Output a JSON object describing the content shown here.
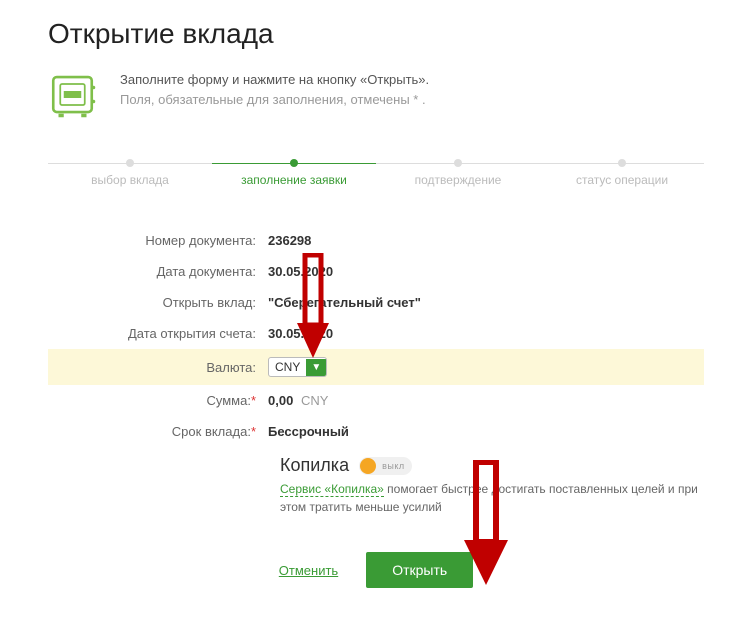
{
  "title": "Открытие вклада",
  "intro": {
    "line1": "Заполните форму и нажмите на кнопку «Открыть».",
    "line2": "Поля, обязательные для заполнения, отмечены * ."
  },
  "steps": {
    "s1": "выбор вклада",
    "s2": "заполнение заявки",
    "s3": "подтверждение",
    "s4": "статус операции"
  },
  "form": {
    "doc_number_label": "Номер документа:",
    "doc_number_value": "236298",
    "doc_date_label": "Дата документа:",
    "doc_date_value": "30.05.2020",
    "deposit_type_label": "Открыть вклад:",
    "deposit_type_value": "\"Сберегательный счет\"",
    "open_date_label": "Дата открытия счета:",
    "open_date_value": "30.05.2020",
    "currency_label": "Валюта:",
    "currency_value": "CNY",
    "amount_label": "Сумма:",
    "amount_value": "0,00",
    "amount_currency": "CNY",
    "term_label": "Срок вклада:",
    "term_value": "Бессрочный"
  },
  "kopilka": {
    "title": "Копилка",
    "toggle_label": "выкл",
    "link_text": "Сервис «Копилка»",
    "desc_rest": " помогает быстрее достигать поставленных целей и при этом тратить меньше усилий"
  },
  "actions": {
    "cancel": "Отменить",
    "submit": "Открыть"
  }
}
